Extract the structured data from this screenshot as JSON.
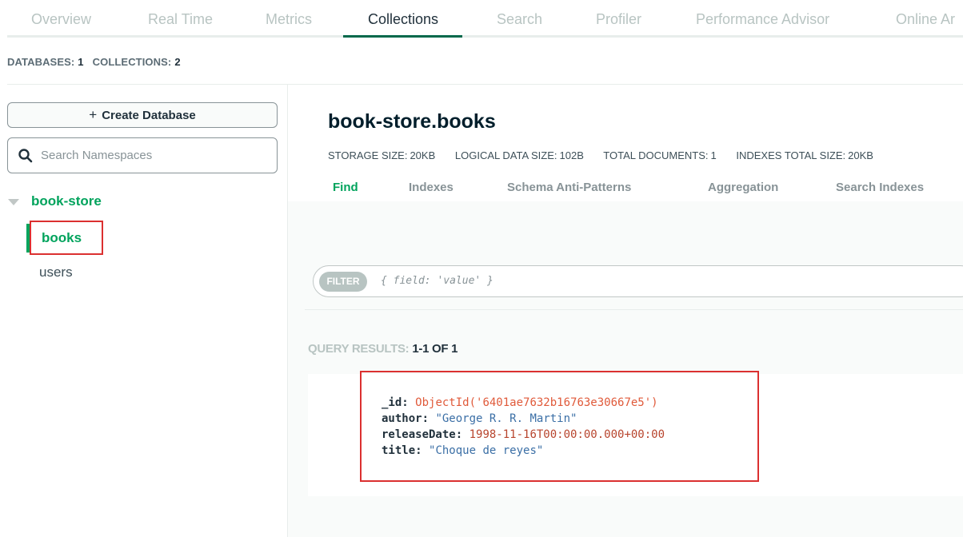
{
  "top_tabs": [
    {
      "label": "Overview"
    },
    {
      "label": "Real Time"
    },
    {
      "label": "Metrics"
    },
    {
      "label": "Collections",
      "active": true
    },
    {
      "label": "Search"
    },
    {
      "label": "Profiler"
    },
    {
      "label": "Performance Advisor"
    },
    {
      "label": "Online Ar"
    }
  ],
  "summary": {
    "databases_label": "DATABASES:",
    "databases_value": "1",
    "collections_label": "COLLECTIONS:",
    "collections_value": "2"
  },
  "sidebar": {
    "create_database_label": "Create Database",
    "search_placeholder": "Search Namespaces",
    "database": "book-store",
    "collections": [
      {
        "label": "books",
        "active": true
      },
      {
        "label": "users",
        "active": false
      }
    ]
  },
  "main": {
    "title": "book-store.books",
    "stats": [
      {
        "label": "STORAGE SIZE:",
        "value": "20KB"
      },
      {
        "label": "LOGICAL DATA SIZE:",
        "value": "102B"
      },
      {
        "label": "TOTAL DOCUMENTS:",
        "value": "1"
      },
      {
        "label": "INDEXES TOTAL SIZE:",
        "value": "20KB"
      }
    ],
    "tabs": [
      {
        "label": "Find",
        "active": true
      },
      {
        "label": "Indexes"
      },
      {
        "label": "Schema Anti-Patterns"
      },
      {
        "label": "Aggregation"
      },
      {
        "label": "Search Indexes"
      }
    ],
    "filter": {
      "pill": "FILTER",
      "placeholder": "{ field: 'value' }"
    },
    "query_results_label": "QUERY RESULTS:",
    "query_results_count": "1-1 OF 1",
    "document": {
      "fields": [
        {
          "key": "_id:",
          "value": "ObjectId('6401ae7632b16763e30667e5')"
        },
        {
          "key": "author:",
          "value": "\"George R. R. Martin\""
        },
        {
          "key": "releaseDate:",
          "value": "1998-11-16T00:00:00.000+00:00"
        },
        {
          "key": "title:",
          "value": "\"Choque de reyes\""
        }
      ]
    }
  },
  "colors": {
    "accent_green": "#00a35c",
    "active_tab_underline": "#00684a",
    "highlight_red": "#db3030"
  }
}
